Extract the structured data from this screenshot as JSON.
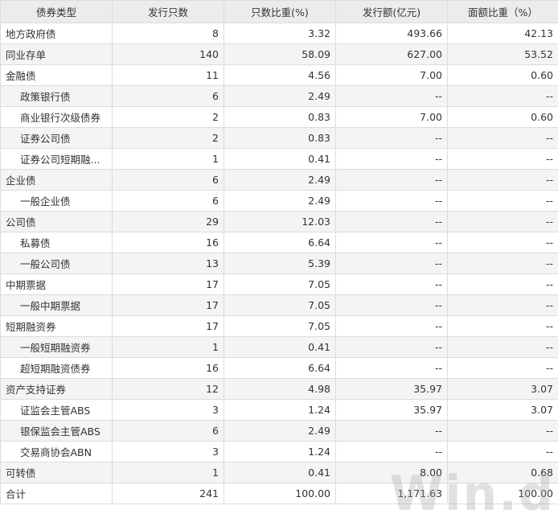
{
  "headers": [
    "债券类型",
    "发行只数",
    "只数比重(%)",
    "发行额(亿元)",
    "面额比重（%）"
  ],
  "rows": [
    {
      "name": "地方政府债",
      "count": "8",
      "count_pct": "3.32",
      "amount": "493.66",
      "amount_pct": "42.13",
      "sub": false
    },
    {
      "name": "同业存单",
      "count": "140",
      "count_pct": "58.09",
      "amount": "627.00",
      "amount_pct": "53.52",
      "sub": false
    },
    {
      "name": "金融债",
      "count": "11",
      "count_pct": "4.56",
      "amount": "7.00",
      "amount_pct": "0.60",
      "sub": false
    },
    {
      "name": "政策银行债",
      "count": "6",
      "count_pct": "2.49",
      "amount": "--",
      "amount_pct": "--",
      "sub": true
    },
    {
      "name": "商业银行次级债券",
      "count": "2",
      "count_pct": "0.83",
      "amount": "7.00",
      "amount_pct": "0.60",
      "sub": true
    },
    {
      "name": "证券公司债",
      "count": "2",
      "count_pct": "0.83",
      "amount": "--",
      "amount_pct": "--",
      "sub": true
    },
    {
      "name": "证券公司短期融...",
      "count": "1",
      "count_pct": "0.41",
      "amount": "--",
      "amount_pct": "--",
      "sub": true
    },
    {
      "name": "企业债",
      "count": "6",
      "count_pct": "2.49",
      "amount": "--",
      "amount_pct": "--",
      "sub": false
    },
    {
      "name": "一般企业债",
      "count": "6",
      "count_pct": "2.49",
      "amount": "--",
      "amount_pct": "--",
      "sub": true
    },
    {
      "name": "公司债",
      "count": "29",
      "count_pct": "12.03",
      "amount": "--",
      "amount_pct": "--",
      "sub": false
    },
    {
      "name": "私募债",
      "count": "16",
      "count_pct": "6.64",
      "amount": "--",
      "amount_pct": "--",
      "sub": true
    },
    {
      "name": "一般公司债",
      "count": "13",
      "count_pct": "5.39",
      "amount": "--",
      "amount_pct": "--",
      "sub": true
    },
    {
      "name": "中期票据",
      "count": "17",
      "count_pct": "7.05",
      "amount": "--",
      "amount_pct": "--",
      "sub": false
    },
    {
      "name": "一般中期票据",
      "count": "17",
      "count_pct": "7.05",
      "amount": "--",
      "amount_pct": "--",
      "sub": true
    },
    {
      "name": "短期融资券",
      "count": "17",
      "count_pct": "7.05",
      "amount": "--",
      "amount_pct": "--",
      "sub": false
    },
    {
      "name": "一般短期融资券",
      "count": "1",
      "count_pct": "0.41",
      "amount": "--",
      "amount_pct": "--",
      "sub": true
    },
    {
      "name": "超短期融资债券",
      "count": "16",
      "count_pct": "6.64",
      "amount": "--",
      "amount_pct": "--",
      "sub": true
    },
    {
      "name": "资产支持证券",
      "count": "12",
      "count_pct": "4.98",
      "amount": "35.97",
      "amount_pct": "3.07",
      "sub": false
    },
    {
      "name": "证监会主管ABS",
      "count": "3",
      "count_pct": "1.24",
      "amount": "35.97",
      "amount_pct": "3.07",
      "sub": true
    },
    {
      "name": "银保监会主管ABS",
      "count": "6",
      "count_pct": "2.49",
      "amount": "--",
      "amount_pct": "--",
      "sub": true
    },
    {
      "name": "交易商协会ABN",
      "count": "3",
      "count_pct": "1.24",
      "amount": "--",
      "amount_pct": "--",
      "sub": true
    },
    {
      "name": "可转债",
      "count": "1",
      "count_pct": "0.41",
      "amount": "8.00",
      "amount_pct": "0.68",
      "sub": false
    },
    {
      "name": "合计",
      "count": "241",
      "count_pct": "100.00",
      "amount": "1,171.63",
      "amount_pct": "100.00",
      "sub": false
    }
  ],
  "watermark": "Win.d"
}
